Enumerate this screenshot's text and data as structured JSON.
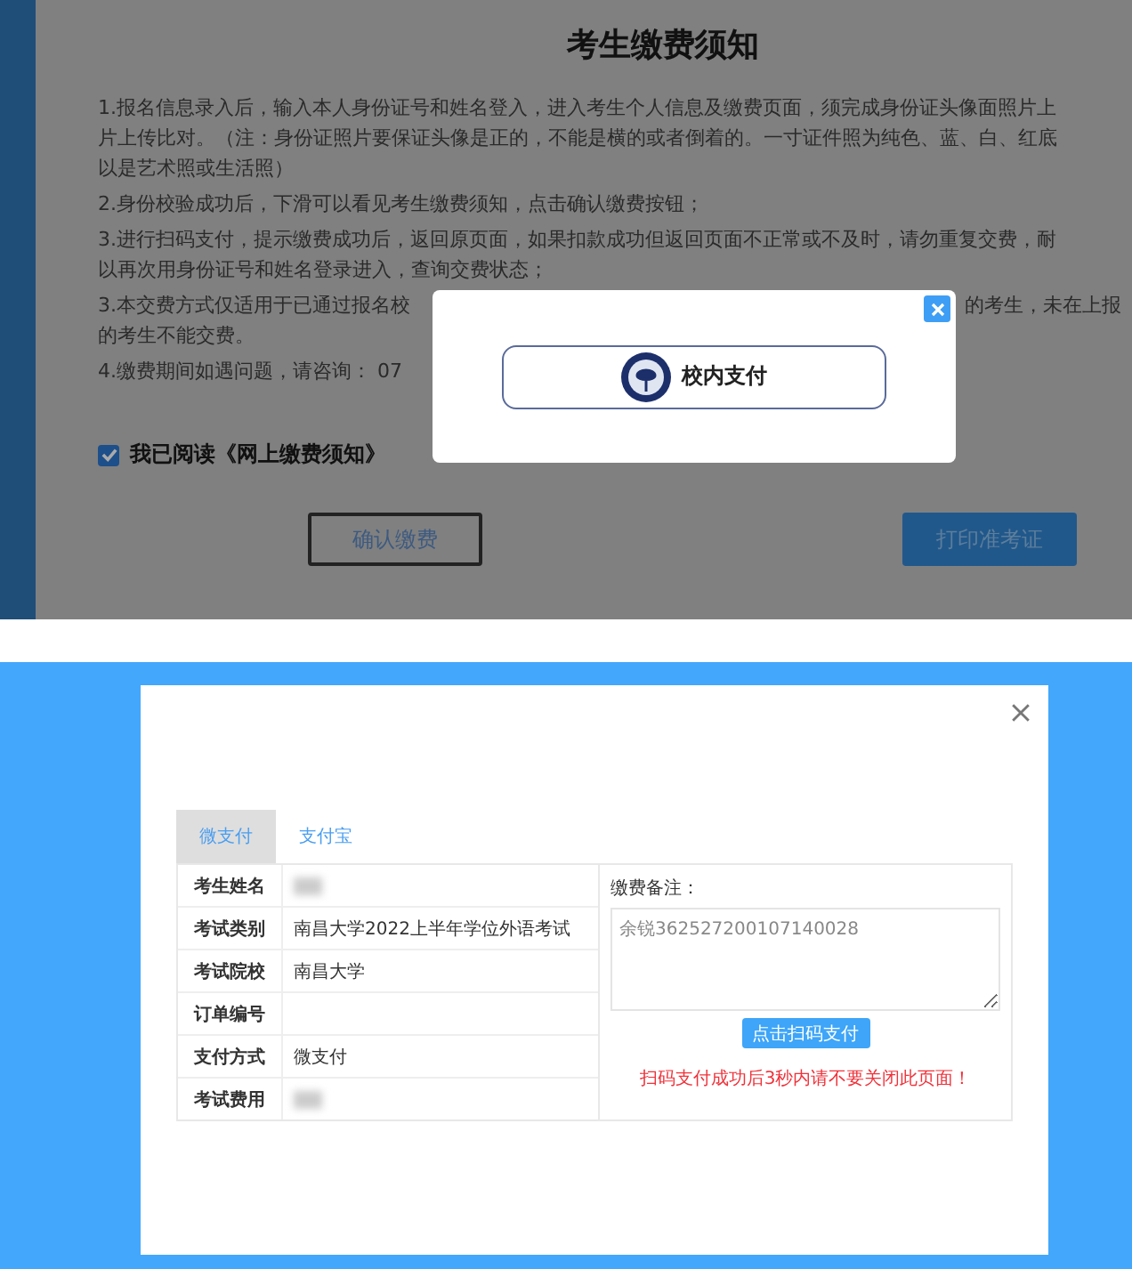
{
  "notice_page": {
    "title": "考生缴费须知",
    "paragraphs": [
      {
        "lines": [
          {
            "left": "1.报名信息录入后，输入本人身份证号和姓名登入，进入考生个人信息及缴费页面，须完成身份证头像面照片上"
          },
          {
            "left": "片上传比对。（注：身份证照片要保证头像是正的，不能是横的或者倒着的。一寸证件照为纯色、蓝、白、红底"
          },
          {
            "left": "以是艺术照或生活照）"
          }
        ]
      },
      {
        "lines": [
          {
            "left": "2.身份校验成功后，下滑可以看见考生缴费须知，点击确认缴费按钮；"
          }
        ]
      },
      {
        "lines": [
          {
            "left": "3.进行扫码支付，提示缴费成功后，返回原页面，如果扣款成功但返回页面不正常或不及时，请勿重复交费，耐"
          },
          {
            "left": "以再次用身份证号和姓名登录进入，查询交费状态；"
          }
        ]
      },
      {
        "lines": [
          {
            "left": "3.本交费方式仅适用于已通过报名校",
            "right": "的考生，未在上报"
          },
          {
            "left": "的考生不能交费。"
          }
        ]
      },
      {
        "lines": [
          {
            "left": "4.缴费期间如遇问题，请咨询：  07"
          }
        ]
      }
    ],
    "agreement": {
      "label": "我已阅读《网上缴费须知》",
      "checked": true
    },
    "buttons": [
      {
        "label": "确认缴费",
        "kind": "outline"
      },
      {
        "label": "打印准考证",
        "kind": "filled"
      }
    ],
    "modal": {
      "option_label": "校内支付"
    }
  },
  "payment_dialog": {
    "tabs": [
      {
        "label": "微支付",
        "selected": true
      },
      {
        "label": "支付宝",
        "selected": false
      }
    ],
    "fields": [
      {
        "label": "考生姓名",
        "kind": "redacted"
      },
      {
        "label": "考试类别",
        "kind": "text",
        "value": "南昌大学2022上半年学位外语考试"
      },
      {
        "label": "考试院校",
        "kind": "text",
        "value": "南昌大学"
      },
      {
        "label": "订单编号",
        "kind": "empty"
      },
      {
        "label": "支付方式",
        "kind": "text",
        "value": "微支付"
      },
      {
        "label": "考试费用",
        "kind": "redacted"
      }
    ],
    "note_label": "缴费备注：",
    "note_value": "余锐362527200107140028",
    "scan_button": "点击扫码支付",
    "warning": "扫码支付成功后3秒内请不要关闭此页面！"
  }
}
